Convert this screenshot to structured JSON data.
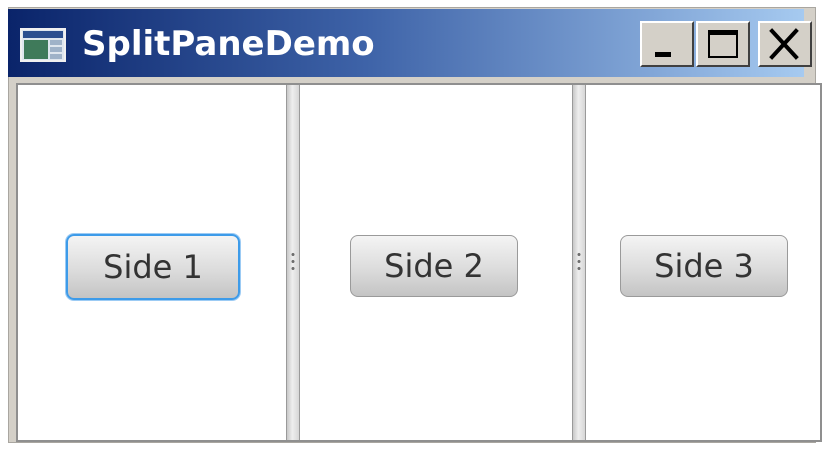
{
  "window": {
    "title": "SplitPaneDemo",
    "controls": {
      "minimize": "minimize",
      "maximize": "maximize",
      "close": "close"
    },
    "titlebar_colors": [
      "#0a246a",
      "#a6caf0"
    ]
  },
  "panes": [
    {
      "button_label": "Side 1",
      "focused": true
    },
    {
      "button_label": "Side 2",
      "focused": false
    },
    {
      "button_label": "Side 3",
      "focused": false
    }
  ],
  "colors": {
    "focus_ring": "#3d9be9",
    "title_text": "#ffffff"
  }
}
